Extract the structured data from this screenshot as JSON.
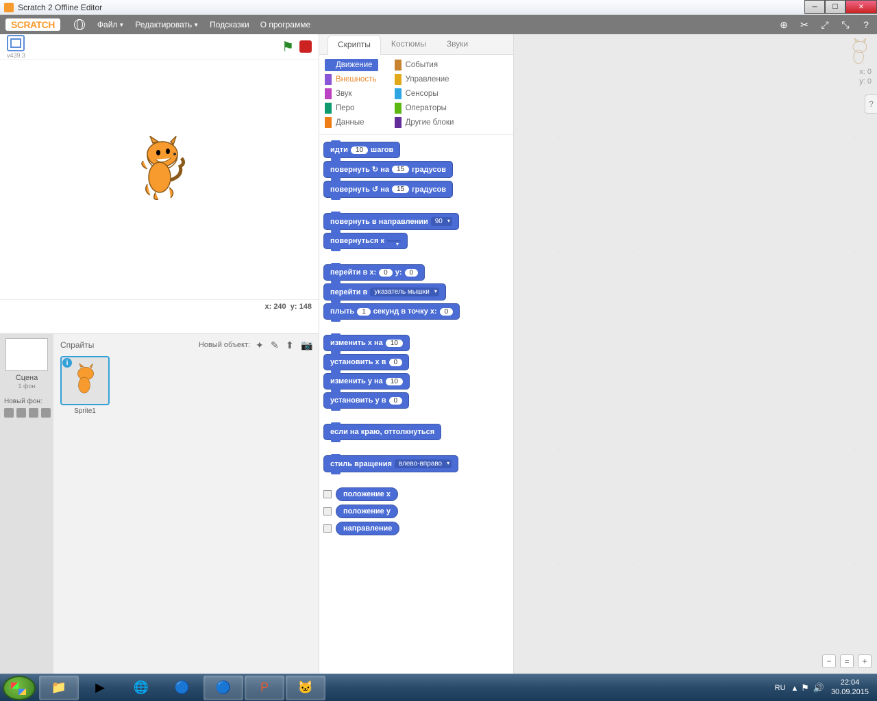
{
  "window": {
    "title": "Scratch 2 Offline Editor"
  },
  "menubar": {
    "logo": "SCRATCH",
    "items": [
      "Файл",
      "Редактировать",
      "Подсказки",
      "О программе"
    ]
  },
  "stage": {
    "version": "v439.3",
    "x_label": "x:",
    "x": "240",
    "y_label": "y:",
    "y": "148"
  },
  "backdrop": {
    "label": "Сцена",
    "sub": "1 фон",
    "new_label": "Новый фон:"
  },
  "sprites": {
    "heading": "Спрайты",
    "new_label": "Новый объект:",
    "items": [
      {
        "name": "Sprite1"
      }
    ]
  },
  "tabs": [
    "Скрипты",
    "Костюмы",
    "Звуки"
  ],
  "categories_left": [
    {
      "name": "Движение",
      "color": "#4a6cd4",
      "selected": true
    },
    {
      "name": "Внешность",
      "color": "#8a55d7",
      "text": "#e6892e"
    },
    {
      "name": "Звук",
      "color": "#bb42c3"
    },
    {
      "name": "Перо",
      "color": "#0e9a6c"
    },
    {
      "name": "Данные",
      "color": "#ee7d16"
    }
  ],
  "categories_right": [
    {
      "name": "События",
      "color": "#c88330"
    },
    {
      "name": "Управление",
      "color": "#e1a91a"
    },
    {
      "name": "Сенсоры",
      "color": "#2ca5e2"
    },
    {
      "name": "Операторы",
      "color": "#5cb712"
    },
    {
      "name": "Другие блоки",
      "color": "#632d99"
    }
  ],
  "blocks": {
    "b1": {
      "pre": "идти",
      "val": "10",
      "post": "шагов"
    },
    "b2": {
      "pre": "повернуть ↻ на",
      "val": "15",
      "post": "градусов"
    },
    "b3": {
      "pre": "повернуть ↺ на",
      "val": "15",
      "post": "градусов"
    },
    "b4": {
      "pre": "повернуть в направлении",
      "dd": "90"
    },
    "b5": {
      "pre": "повернуться к",
      "dd": " "
    },
    "b6": {
      "pre": "перейти в x:",
      "v1": "0",
      "mid": "y:",
      "v2": "0"
    },
    "b7": {
      "pre": "перейти в",
      "dd": "указатель мышки"
    },
    "b8": {
      "pre": "плыть",
      "v1": "1",
      "mid": "секунд в точку x:",
      "v2": "0"
    },
    "b9": {
      "pre": "изменить x на",
      "val": "10"
    },
    "b10": {
      "pre": "установить x в",
      "val": "0"
    },
    "b11": {
      "pre": "изменить y на",
      "val": "10"
    },
    "b12": {
      "pre": "установить y в",
      "val": "0"
    },
    "b13": {
      "text": "если на краю, оттолкнуться"
    },
    "b14": {
      "pre": "стиль вращения",
      "dd": "влево-вправо"
    },
    "r1": "положение x",
    "r2": "положение y",
    "r3": "направление"
  },
  "scriptpane": {
    "x_label": "x:",
    "x": "0",
    "y_label": "y:",
    "y": "0"
  },
  "tray": {
    "lang": "RU",
    "time": "22:04",
    "date": "30.09.2015"
  }
}
